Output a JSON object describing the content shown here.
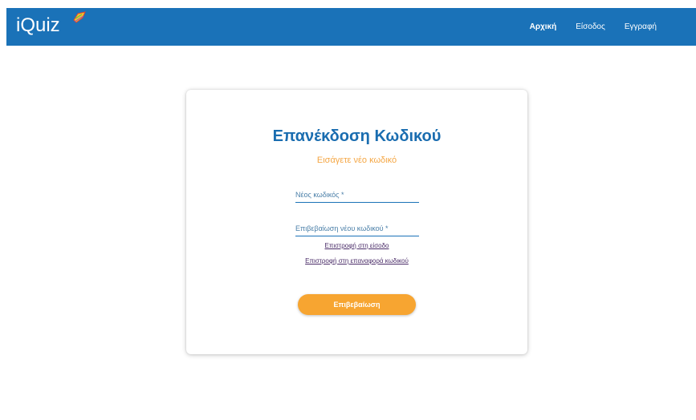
{
  "navbar": {
    "logo_text": "iQuiz",
    "brand_color": "#1a72b8",
    "links": [
      {
        "label": "Αρχική",
        "active": true
      },
      {
        "label": "Είσοδος",
        "active": false
      },
      {
        "label": "Εγγραφή",
        "active": false
      }
    ]
  },
  "card": {
    "title": "Επανέκδοση Κωδικού",
    "subtitle": "Εισάγετε νέο κωδικό",
    "fields": {
      "new_password_placeholder": "Νέος κωδικός *",
      "confirm_password_placeholder": "Επιβεβαίωση νέου κωδικού *"
    },
    "links": {
      "back_to_login": "Επιστροφή στη είσοδο",
      "back_to_reset": "Επιστροφή στη επαναφορά κωδικού"
    },
    "submit_label": "Επιβεβαίωση",
    "colors": {
      "title": "#1a6db0",
      "subtitle": "#f5a745",
      "button": "#f7a531"
    }
  }
}
